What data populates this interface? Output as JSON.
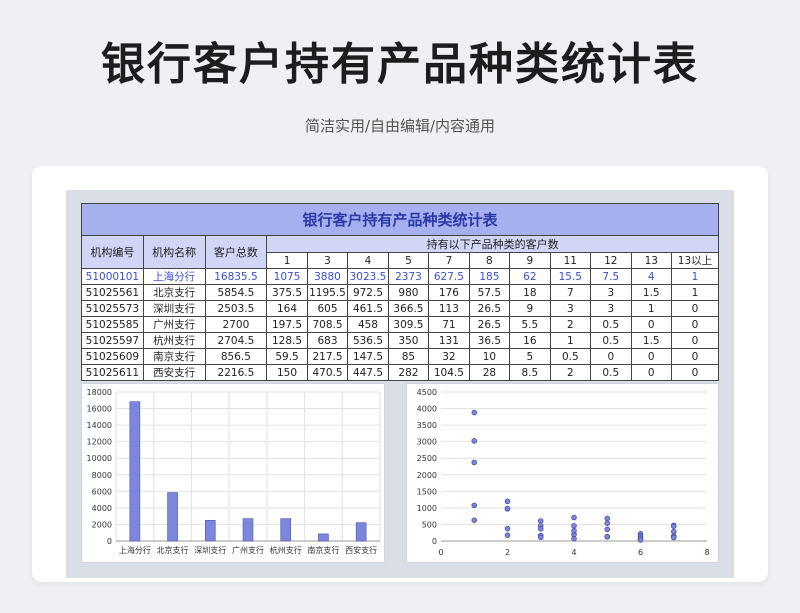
{
  "page": {
    "title": "银行客户持有产品种类统计表",
    "subtitle": "简洁实用/自由编辑/内容通用"
  },
  "table": {
    "title": "银行客户持有产品种类统计表",
    "headers": {
      "code": "机构编号",
      "name": "机构名称",
      "total": "客户总数",
      "span": "持有以下产品种类的客户数"
    },
    "subheaders": [
      "1",
      "3",
      "4",
      "5",
      "7",
      "8",
      "9",
      "11",
      "12",
      "13",
      "13以上"
    ],
    "rows": [
      [
        "51000101",
        "上海分行",
        "16835.5",
        "1075",
        "3880",
        "3023.5",
        "2373",
        "627.5",
        "185",
        "62",
        "15.5",
        "7.5",
        "4",
        "1"
      ],
      [
        "51025561",
        "北京支行",
        "5854.5",
        "375.5",
        "1195.5",
        "972.5",
        "980",
        "176",
        "57.5",
        "18",
        "7",
        "3",
        "1.5",
        "1"
      ],
      [
        "51025573",
        "深圳支行",
        "2503.5",
        "164",
        "605",
        "461.5",
        "366.5",
        "113",
        "26.5",
        "9",
        "3",
        "3",
        "1",
        "0"
      ],
      [
        "51025585",
        "广州支行",
        "2700",
        "197.5",
        "708.5",
        "458",
        "309.5",
        "71",
        "26.5",
        "5.5",
        "2",
        "0.5",
        "0",
        "0"
      ],
      [
        "51025597",
        "杭州支行",
        "2704.5",
        "128.5",
        "683",
        "536.5",
        "350",
        "131",
        "36.5",
        "16",
        "1",
        "0.5",
        "1.5",
        "0"
      ],
      [
        "51025609",
        "南京支行",
        "856.5",
        "59.5",
        "217.5",
        "147.5",
        "85",
        "32",
        "10",
        "5",
        "0.5",
        "0",
        "0",
        "0"
      ],
      [
        "51025611",
        "西安支行",
        "2216.5",
        "150",
        "470.5",
        "447.5",
        "282",
        "104.5",
        "28",
        "8.5",
        "2",
        "0.5",
        "0",
        "0"
      ]
    ]
  },
  "chart_data": [
    {
      "type": "bar",
      "categories": [
        "上海分行",
        "北京支行",
        "深圳支行",
        "广州支行",
        "杭州支行",
        "南京支行",
        "西安支行"
      ],
      "values": [
        16835.5,
        5854.5,
        2503.5,
        2700,
        2704.5,
        856.5,
        2216.5
      ],
      "ylim": [
        0,
        18000
      ],
      "yticks": [
        "0",
        "2000",
        "4000",
        "6000",
        "8000",
        "10000",
        "12000",
        "14000",
        "16000",
        "18000"
      ],
      "grid": true,
      "bar_color": "#7b86dc"
    },
    {
      "type": "scatter",
      "xlim": [
        0,
        8
      ],
      "ylim": [
        0,
        4500
      ],
      "xticks": [
        "0",
        "2",
        "4",
        "6",
        "8"
      ],
      "yticks": [
        "0",
        "500",
        "1000",
        "1500",
        "2000",
        "2500",
        "3000",
        "3500",
        "4000",
        "4500"
      ],
      "grid": true,
      "point_color": "#7b86dc",
      "points": [
        [
          1,
          1075
        ],
        [
          1,
          3880
        ],
        [
          1,
          3023.5
        ],
        [
          1,
          2373
        ],
        [
          1,
          627.5
        ],
        [
          2,
          375.5
        ],
        [
          2,
          1195.5
        ],
        [
          2,
          972.5
        ],
        [
          2,
          980
        ],
        [
          2,
          176
        ],
        [
          3,
          164
        ],
        [
          3,
          605
        ],
        [
          3,
          461.5
        ],
        [
          3,
          366.5
        ],
        [
          3,
          113
        ],
        [
          4,
          197.5
        ],
        [
          4,
          708.5
        ],
        [
          4,
          458
        ],
        [
          4,
          309.5
        ],
        [
          4,
          71
        ],
        [
          5,
          128.5
        ],
        [
          5,
          683
        ],
        [
          5,
          536.5
        ],
        [
          5,
          350
        ],
        [
          5,
          131
        ],
        [
          6,
          59.5
        ],
        [
          6,
          217.5
        ],
        [
          6,
          147.5
        ],
        [
          6,
          85
        ],
        [
          6,
          32
        ],
        [
          7,
          150
        ],
        [
          7,
          470.5
        ],
        [
          7,
          447.5
        ],
        [
          7,
          282
        ],
        [
          7,
          104.5
        ]
      ]
    }
  ]
}
